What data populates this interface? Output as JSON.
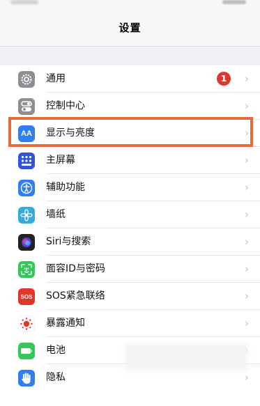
{
  "header": {
    "title": "设置"
  },
  "settings": {
    "items": [
      {
        "label": "通用",
        "icon": "gear-icon",
        "color": "#8e8e93",
        "badge": "1"
      },
      {
        "label": "控制中心",
        "icon": "toggles-icon",
        "color": "#8e8e93"
      },
      {
        "label": "显示与亮度",
        "icon": "display-aa-icon",
        "color": "#2f7ef5",
        "icon_text": "AA"
      },
      {
        "label": "主屏幕",
        "icon": "home-grid-icon",
        "color": "#3155d6"
      },
      {
        "label": "辅助功能",
        "icon": "accessibility-icon",
        "color": "#2f7ef5"
      },
      {
        "label": "墙纸",
        "icon": "wallpaper-flower-icon",
        "color": "#36aadc"
      },
      {
        "label": "Siri与搜索",
        "icon": "siri-icon",
        "color": "#222222"
      },
      {
        "label": "面容ID与密码",
        "icon": "face-id-icon",
        "color": "#34c759"
      },
      {
        "label": "SOS紧急联络",
        "icon": "sos-icon",
        "color": "#e3352b",
        "icon_text": "SOS"
      },
      {
        "label": "暴露通知",
        "icon": "exposure-icon",
        "color": "#ffffff"
      },
      {
        "label": "电池",
        "icon": "battery-icon",
        "color": "#34c759"
      },
      {
        "label": "隐私",
        "icon": "hand-privacy-icon",
        "color": "#2f7ef5"
      }
    ],
    "chevron": "›"
  }
}
